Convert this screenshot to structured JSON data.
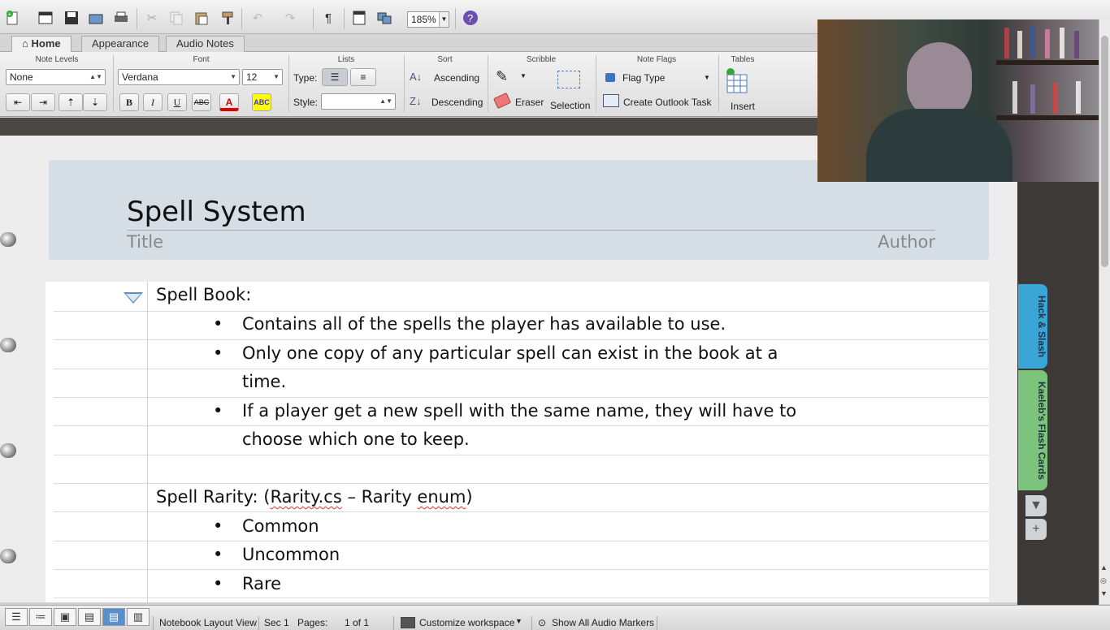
{
  "toolbar": {
    "zoom": "185%",
    "icons": [
      "new-icon",
      "calendar-icon",
      "save-icon",
      "open-icon",
      "print-icon",
      "cut-icon",
      "copy-icon",
      "paste-icon",
      "format-painter-icon",
      "undo-icon",
      "redo-icon",
      "pilcrow-icon",
      "view-icon",
      "gallery-icon",
      "help-icon"
    ]
  },
  "tabs": [
    {
      "label": "Home"
    },
    {
      "label": "Appearance"
    },
    {
      "label": "Audio Notes"
    }
  ],
  "ribbon": {
    "note_levels": {
      "title": "Note Levels",
      "value": "None"
    },
    "font": {
      "title": "Font",
      "family": "Verdana",
      "size": "12",
      "bold": "B",
      "italic": "I",
      "underline": "U",
      "strike": "ABC",
      "color_a": "A",
      "highlight": "ABC"
    },
    "lists": {
      "title": "Lists",
      "type_label": "Type:",
      "style_label": "Style:"
    },
    "sort": {
      "title": "Sort",
      "ascending": "Ascending",
      "descending": "Descending"
    },
    "scribble": {
      "title": "Scribble",
      "eraser": "Eraser",
      "selection": "Selection"
    },
    "note_flags": {
      "title": "Note Flags",
      "flag_type": "Flag Type",
      "outlook_task": "Create Outlook Task"
    },
    "tables": {
      "title": "Tables",
      "insert": "Insert"
    }
  },
  "page": {
    "title": "Spell System",
    "title_label": "Title",
    "author_label": "Author"
  },
  "notes": {
    "heading1": "Spell Book:",
    "bullets1": [
      "Contains all of the spells the player has available to use.",
      "Only one copy of any particular spell can exist in the book at a",
      "time.",
      "If a player get a new spell with the same name, they will have to",
      "choose which one to keep."
    ],
    "heading2_a": "Spell Rarity: (",
    "heading2_b": "Rarity.cs",
    "heading2_c": " – Rarity ",
    "heading2_d": "enum",
    "heading2_e": ")",
    "bullets2": [
      "Common",
      "Uncommon",
      "Rare"
    ],
    "bullet_char": "•"
  },
  "side_tabs": [
    {
      "label": "Hack & Slash",
      "color": "#3aa6d8"
    },
    {
      "label": "Kaeleb's Flash Cards",
      "color": "#7cc47c"
    }
  ],
  "status": {
    "view": "Notebook Layout View",
    "section": "Sec 1",
    "pages_label": "Pages:",
    "pages_value": "1 of 1",
    "workspace": "Customize workspace",
    "audio": "Show All Audio Markers"
  }
}
